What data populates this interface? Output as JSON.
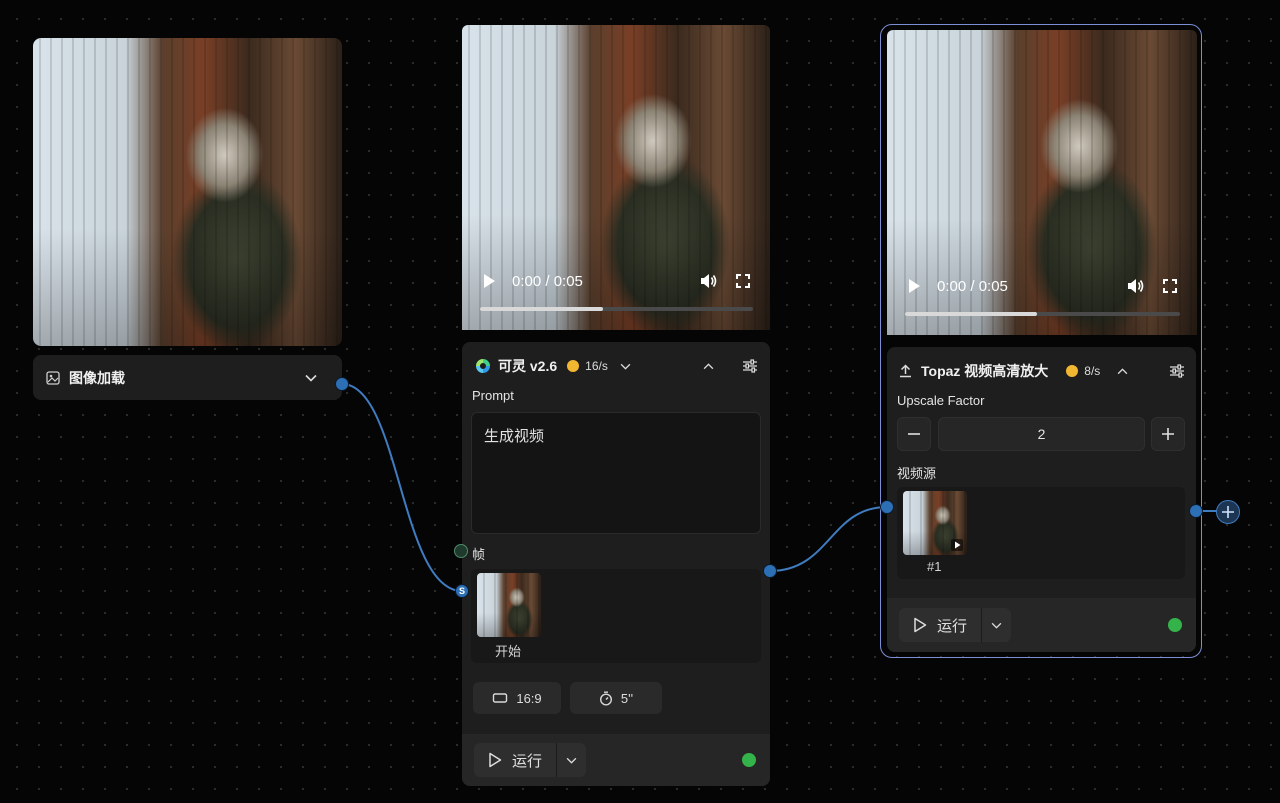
{
  "image_node": {
    "title": "图像加载",
    "icons": {
      "title": "image-icon",
      "expand": "chevron-down-icon"
    }
  },
  "kling_node": {
    "video": {
      "time": "0:00 / 0:05",
      "progress": 0.45
    },
    "model_name": "可灵 v2.6",
    "rate": "16/s",
    "prompt_label": "Prompt",
    "prompt_value": "生成视频",
    "frame_label": "帧",
    "frame_start_label": "开始",
    "frame_port_badge": "S",
    "aspect_ratio": "16:9",
    "duration": "5''",
    "run_label": "运行",
    "colors": {
      "status": "#34b34a",
      "cost_dot": "#f2b731",
      "accent": "#2c6fb5"
    }
  },
  "topaz_node": {
    "video": {
      "time": "0:00 / 0:05",
      "progress": 0.48
    },
    "title": "Topaz 视频高清放大",
    "rate": "8/s",
    "upscale_label": "Upscale Factor",
    "upscale_value": "2",
    "video_source_label": "视频源",
    "source_item_label": "#1",
    "run_label": "运行"
  }
}
